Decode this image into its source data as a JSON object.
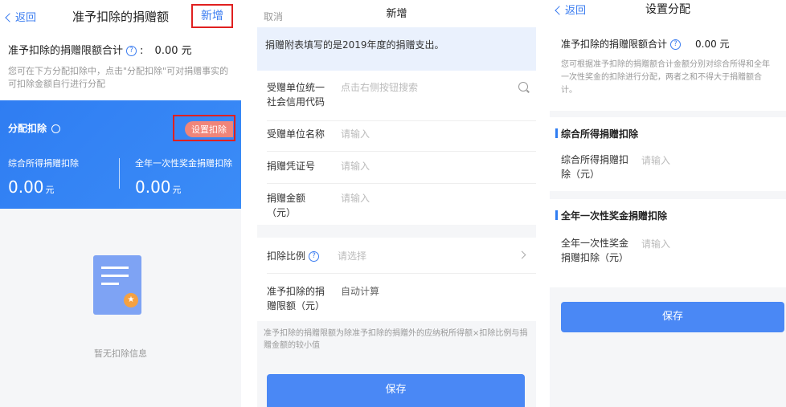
{
  "panel1": {
    "back_label": "返回",
    "title": "准予扣除的捐赠额",
    "add_label": "新增",
    "sum_label": "准予扣除的捐赠限额合计",
    "sum_colon": ":",
    "sum_value": "0.00 元",
    "sum_tip": "您可在下方分配扣除中，点击\"分配扣除\"可对捐赠事实的可扣除金额自行进行分配",
    "alloc_title": "分配扣除",
    "set_label": "设置扣除",
    "col1_label": "综合所得捐赠扣除",
    "col1_value": "0.00",
    "col2_label": "全年一次性奖金捐赠扣除",
    "col2_value": "0.00",
    "unit": "元",
    "empty_msg": "暂无扣除信息"
  },
  "panel2": {
    "cancel_label": "取消",
    "title": "新增",
    "notice": "捐赠附表填写的是2019年度的捐赠支出。",
    "fields": [
      {
        "label": "受赠单位统一社会信用代码",
        "value": "点击右侧按钮搜索"
      },
      {
        "label": "受赠单位名称",
        "value": "请输入"
      },
      {
        "label": "捐赠凭证号",
        "value": "请输入"
      },
      {
        "label": "捐赠金额（元）",
        "value": "请输入"
      }
    ],
    "ratio_label": "扣除比例",
    "ratio_value": "请选择",
    "limit_label": "准予扣除的捐赠限额（元）",
    "limit_value": "自动计算",
    "note": "准予扣除的捐赠限额为除准予扣除的捐赠外的应纳税所得额×扣除比例与捐赠金额的较小值",
    "save_label": "保存"
  },
  "panel3": {
    "back_label": "返回",
    "title": "设置分配",
    "sum_label": "准予扣除的捐赠限额合计",
    "sum_value": "0.00 元",
    "sum_tip": "您可根据准予扣除的捐赠额合计金额分别对综合所得和全年一次性奖金的扣除进行分配，两者之和不得大于捐赠额合计。",
    "sec1_title": "综合所得捐赠扣除",
    "sec1_field": "综合所得捐赠扣除（元）",
    "sec2_title": "全年一次性奖金捐赠扣除",
    "sec2_field": "全年一次性奖金捐赠扣除（元）",
    "placeholder": "请输入",
    "save_label": "保存"
  },
  "colors": {
    "accent": "#3a7cf0",
    "highlight": "#e02020",
    "badge": "#f0857a"
  }
}
